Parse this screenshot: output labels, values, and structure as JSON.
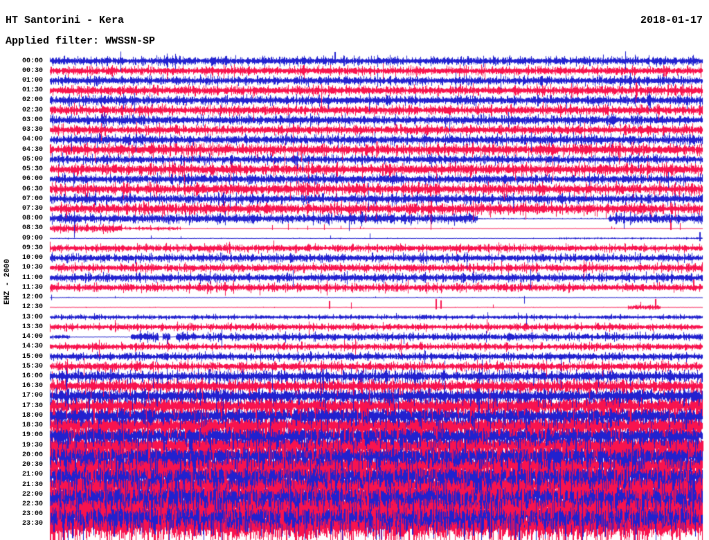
{
  "header": {
    "station_title": "HT Santorini - Kera",
    "date": "2018-01-17",
    "filter_label": "Applied filter: WWSSN-SP"
  },
  "chart_data": {
    "type": "helicorder",
    "title": "HT Santorini - Kera",
    "date": "2018-01-17",
    "filter": "WWSSN-SP",
    "channel": "EHZ - 2000",
    "minutes_per_line": 30,
    "time_range": [
      "00:00",
      "23:30"
    ],
    "legend_position": "none",
    "grid": false,
    "colors": {
      "blue": "#2121cf",
      "red": "#f8134e"
    },
    "row_labels": [
      "00:00",
      "00:30",
      "01:00",
      "01:30",
      "02:00",
      "02:30",
      "03:00",
      "03:30",
      "04:00",
      "04:30",
      "05:00",
      "05:30",
      "06:00",
      "06:30",
      "07:00",
      "07:30",
      "08:00",
      "08:30",
      "09:00",
      "09:30",
      "10:00",
      "10:30",
      "11:00",
      "11:30",
      "12:00",
      "12:30",
      "13:00",
      "13:30",
      "14:00",
      "14:30",
      "15:00",
      "15:30",
      "16:00",
      "16:30",
      "17:00",
      "17:30",
      "18:00",
      "18:30",
      "19:00",
      "19:30",
      "20:00",
      "20:30",
      "21:00",
      "21:30",
      "22:00",
      "22:30",
      "23:00",
      "23:30"
    ],
    "rows": [
      {
        "t": "00:00",
        "color": "blue",
        "amp": 5.5,
        "spikes": [
          [
            0.436,
            13,
            3
          ]
        ]
      },
      {
        "t": "00:30",
        "color": "red",
        "amp": 5.5
      },
      {
        "t": "01:00",
        "color": "blue",
        "amp": 5.5
      },
      {
        "t": "01:30",
        "color": "red",
        "amp": 6
      },
      {
        "t": "02:00",
        "color": "blue",
        "amp": 6
      },
      {
        "t": "02:30",
        "color": "red",
        "amp": 6
      },
      {
        "t": "03:00",
        "color": "blue",
        "amp": 6
      },
      {
        "t": "03:30",
        "color": "red",
        "amp": 6
      },
      {
        "t": "04:00",
        "color": "blue",
        "amp": 6
      },
      {
        "t": "04:30",
        "color": "red",
        "amp": 6.5
      },
      {
        "t": "05:00",
        "color": "blue",
        "amp": 5.5
      },
      {
        "t": "05:30",
        "color": "red",
        "amp": 6.5
      },
      {
        "t": "06:00",
        "color": "blue",
        "amp": 6
      },
      {
        "t": "06:30",
        "color": "red",
        "amp": 6.5
      },
      {
        "t": "07:00",
        "color": "blue",
        "amp": 6
      },
      {
        "t": "07:30",
        "color": "red",
        "amp": 6.5
      },
      {
        "t": "08:00",
        "color": "blue",
        "amp": 6,
        "segments": [
          [
            0.655,
            0.855,
            0.7
          ]
        ]
      },
      {
        "t": "08:30",
        "color": "red",
        "amp": 0.35,
        "segments": [
          [
            0,
            0.11,
            5
          ],
          [
            0.11,
            0.2,
            2.2
          ]
        ],
        "spikes": [
          [
            0.34,
            5,
            2
          ],
          [
            0.365,
            7,
            2
          ],
          [
            0.395,
            4,
            2
          ],
          [
            0.42,
            6,
            2
          ],
          [
            0.445,
            4,
            1
          ],
          [
            0.475,
            3,
            1
          ],
          [
            0.86,
            3,
            1
          ],
          [
            0.95,
            13,
            2
          ],
          [
            0.965,
            8,
            2
          ]
        ]
      },
      {
        "t": "09:00",
        "color": "blue",
        "amp": 0.5,
        "segments": [
          [
            0.78,
            1,
            1.1
          ]
        ],
        "spikes": [
          [
            0.155,
            4,
            1
          ],
          [
            0.2,
            3,
            1
          ],
          [
            0.43,
            4,
            1
          ],
          [
            0.49,
            7,
            1
          ],
          [
            0.995,
            9,
            4
          ]
        ]
      },
      {
        "t": "09:30",
        "color": "red",
        "amp": 4.5
      },
      {
        "t": "10:00",
        "color": "blue",
        "amp": 5
      },
      {
        "t": "10:30",
        "color": "red",
        "amp": 5
      },
      {
        "t": "11:00",
        "color": "blue",
        "amp": 5.2
      },
      {
        "t": "11:30",
        "color": "red",
        "amp": 5,
        "spikes": [
          [
            0.985,
            12,
            4
          ]
        ]
      },
      {
        "t": "12:00",
        "color": "blue",
        "amp": 0.45,
        "spikes": [
          [
            0.002,
            4,
            4
          ],
          [
            0.1,
            2,
            1
          ],
          [
            0.726,
            2,
            9
          ]
        ]
      },
      {
        "t": "12:30",
        "color": "red",
        "amp": 0.45,
        "segments": [
          [
            0.885,
            0.935,
            3
          ]
        ],
        "spikes": [
          [
            0.427,
            9,
            2
          ],
          [
            0.461,
            7,
            2
          ],
          [
            0.591,
            12,
            3
          ],
          [
            0.598,
            10,
            2
          ],
          [
            0.679,
            4,
            1
          ],
          [
            0.905,
            8,
            3
          ],
          [
            0.927,
            12,
            3
          ]
        ]
      },
      {
        "t": "13:00",
        "color": "blue",
        "amp": 2.8,
        "spikes": [
          [
            0.53,
            6,
            2
          ],
          [
            0.67,
            7,
            2
          ],
          [
            0.81,
            6,
            2
          ]
        ]
      },
      {
        "t": "13:30",
        "color": "red",
        "amp": 4.2
      },
      {
        "t": "14:00",
        "color": "blue",
        "amp": 4.6,
        "segments": [
          [
            0,
            0.03,
            2.5
          ],
          [
            0.03,
            0.124,
            0.45
          ],
          [
            0.124,
            0.166,
            6
          ],
          [
            0.166,
            0.172,
            0.6
          ],
          [
            0.172,
            0.184,
            6
          ],
          [
            0.184,
            0.192,
            0.6
          ],
          [
            0.192,
            0.206,
            6
          ]
        ]
      },
      {
        "t": "14:30",
        "color": "red",
        "amp": 4.4
      },
      {
        "t": "15:00",
        "color": "blue",
        "amp": 5
      },
      {
        "t": "15:30",
        "color": "red",
        "amp": 5.5
      },
      {
        "t": "16:00",
        "color": "blue",
        "amp": 6.5
      },
      {
        "t": "16:30",
        "color": "red",
        "amp": 7.5
      },
      {
        "t": "17:00",
        "color": "blue",
        "amp": 9
      },
      {
        "t": "17:30",
        "color": "red",
        "amp": 10.5
      },
      {
        "t": "18:00",
        "color": "blue",
        "amp": 11.5
      },
      {
        "t": "18:30",
        "color": "red",
        "amp": 12.5
      },
      {
        "t": "19:00",
        "color": "blue",
        "amp": 13.5
      },
      {
        "t": "19:30",
        "color": "red",
        "amp": 14.5
      },
      {
        "t": "20:00",
        "color": "blue",
        "amp": 15.5
      },
      {
        "t": "20:30",
        "color": "red",
        "amp": 16.5
      },
      {
        "t": "21:00",
        "color": "blue",
        "amp": 17.5
      },
      {
        "t": "21:30",
        "color": "red",
        "amp": 18.5
      },
      {
        "t": "22:00",
        "color": "blue",
        "amp": 19.5
      },
      {
        "t": "22:30",
        "color": "red",
        "amp": 20.5
      },
      {
        "t": "23:00",
        "color": "blue",
        "amp": 21.5
      },
      {
        "t": "23:30",
        "color": "red",
        "amp": 23
      }
    ]
  }
}
